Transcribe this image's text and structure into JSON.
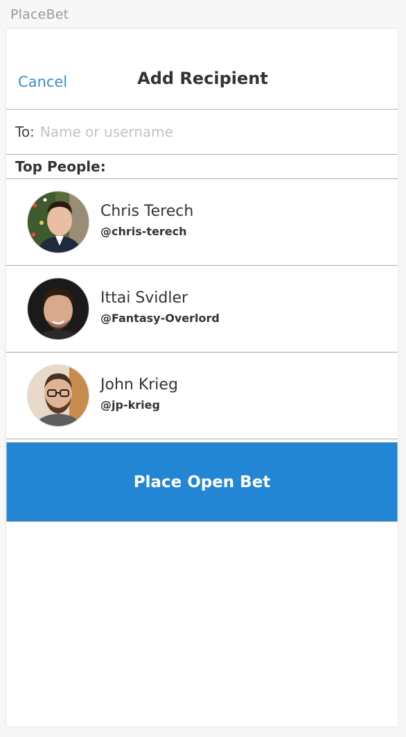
{
  "app": {
    "title": "PlaceBet"
  },
  "nav": {
    "cancel_label": "Cancel",
    "title": "Add Recipient"
  },
  "recipient": {
    "to_label": "To:",
    "placeholder": "Name or username",
    "value": ""
  },
  "top_people": {
    "header": "Top People:",
    "people": [
      {
        "name": "Chris Terech",
        "handle": "@chris-terech"
      },
      {
        "name": "Ittai Svidler",
        "handle": "@Fantasy-Overlord"
      },
      {
        "name": "John Krieg",
        "handle": "@jp-krieg"
      }
    ]
  },
  "actions": {
    "place_open_bet_label": "Place Open Bet"
  },
  "colors": {
    "accent": "#2386d4",
    "link": "#3a8fd4",
    "divider": "#a8a8a8"
  }
}
